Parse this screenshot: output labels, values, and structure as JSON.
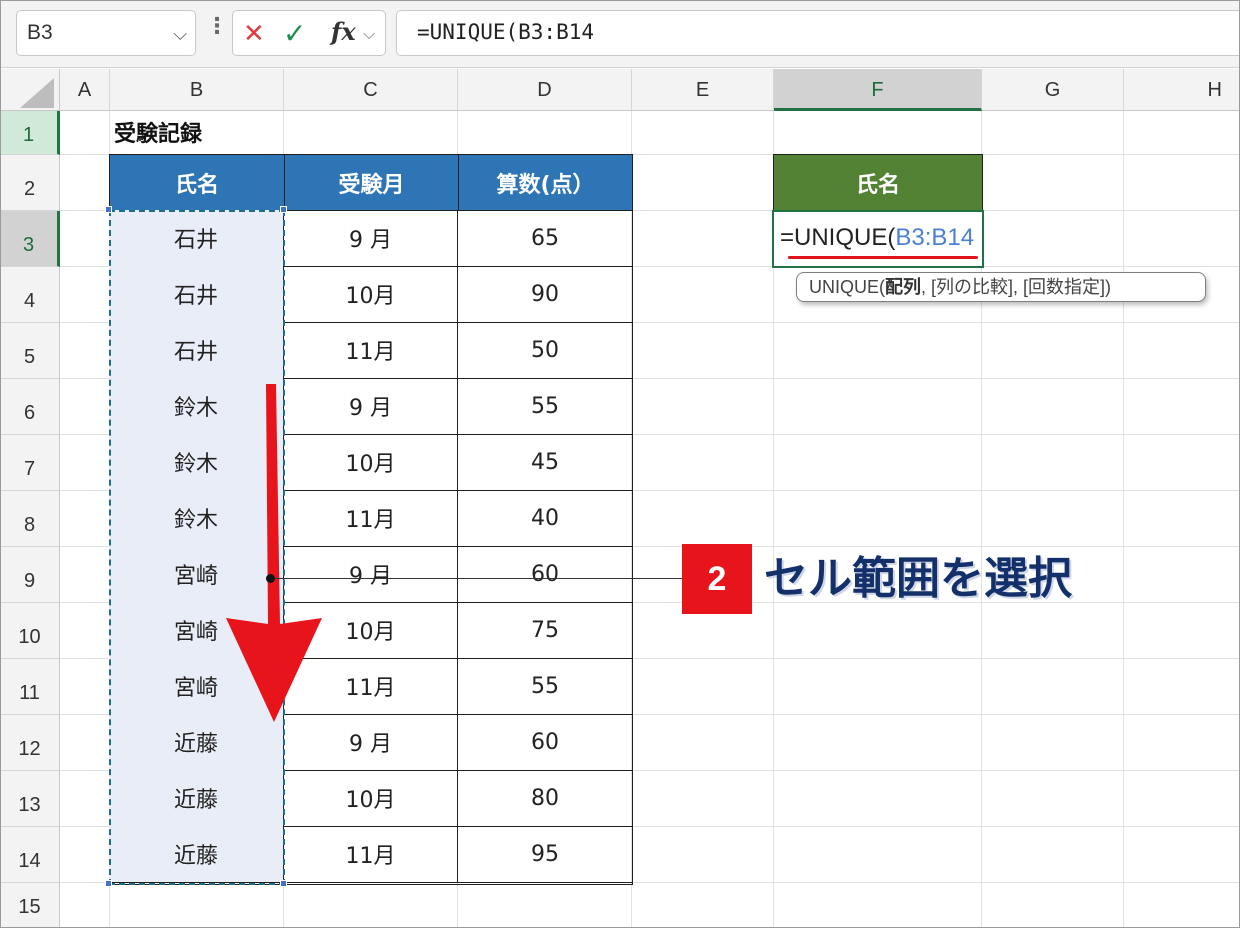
{
  "formula_bar": {
    "name_box": "B3",
    "more_icon": "⋮",
    "cancel_icon": "✕",
    "enter_icon": "✓",
    "fx_icon": "fx",
    "formula": "=UNIQUE(B3:B14"
  },
  "columns": [
    "A",
    "B",
    "C",
    "D",
    "E",
    "F",
    "G",
    "H"
  ],
  "rows": [
    "1",
    "2",
    "3",
    "4",
    "5",
    "6",
    "7",
    "8",
    "9",
    "10",
    "11",
    "12",
    "13",
    "14",
    "15"
  ],
  "sheet": {
    "title": "受験記録",
    "headers": [
      "氏名",
      "受験月",
      "算数(点）"
    ],
    "records": [
      {
        "name": "石井",
        "month": "9 月",
        "score": "65"
      },
      {
        "name": "石井",
        "month": "10月",
        "score": "90"
      },
      {
        "name": "石井",
        "month": "11月",
        "score": "50"
      },
      {
        "name": "鈴木",
        "month": "9 月",
        "score": "55"
      },
      {
        "name": "鈴木",
        "month": "10月",
        "score": "45"
      },
      {
        "name": "鈴木",
        "month": "11月",
        "score": "40"
      },
      {
        "name": "宮崎",
        "month": "9 月",
        "score": "60"
      },
      {
        "name": "宮崎",
        "month": "10月",
        "score": "75"
      },
      {
        "name": "宮崎",
        "month": "11月",
        "score": "55"
      },
      {
        "name": "近藤",
        "month": "9 月",
        "score": "60"
      },
      {
        "name": "近藤",
        "month": "10月",
        "score": "80"
      },
      {
        "name": "近藤",
        "month": "11月",
        "score": "95"
      }
    ],
    "result_header": "氏名",
    "edit_text_func": "=UNIQUE(",
    "edit_text_ref": "B3:B14",
    "tooltip": {
      "prefix": "UNIQUE(",
      "bold_arg": "配列",
      "rest": ", [列の比較], [回数指定])"
    }
  },
  "annotation": {
    "step_number": "2",
    "label": "セル範囲を選択"
  },
  "colors": {
    "table_header": "#2e75b6",
    "result_header": "#548235",
    "selection_dash": "#1f6e8a",
    "arrow": "#e8141c",
    "callout_text": "#14306b"
  }
}
